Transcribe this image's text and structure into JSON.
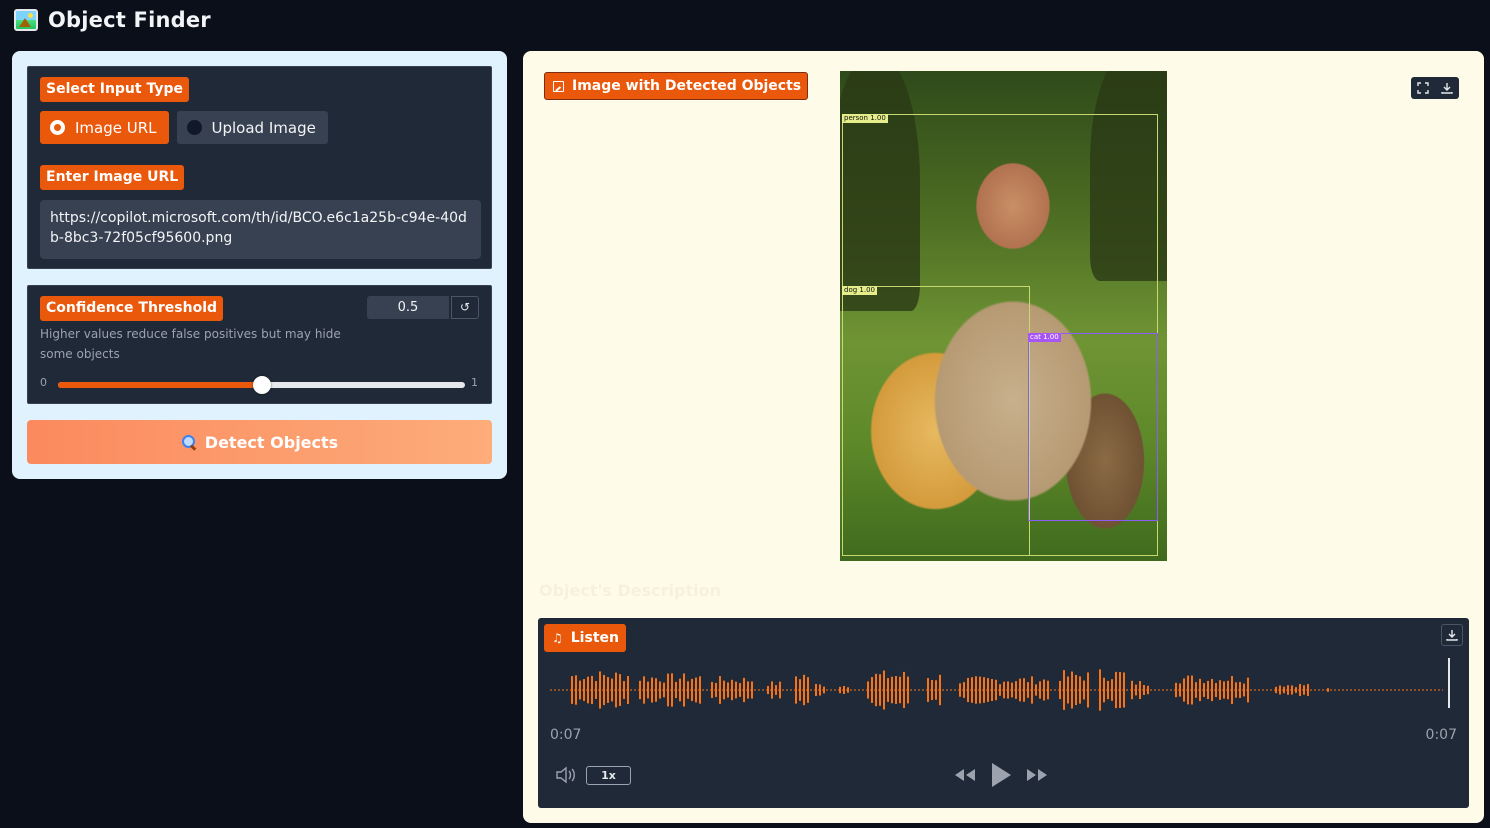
{
  "app": {
    "title": "Object Finder",
    "logo_icon": "framed-picture-icon"
  },
  "input_panel": {
    "input_type": {
      "label": "Select Input Type",
      "options": [
        {
          "label": "Image URL",
          "selected": true
        },
        {
          "label": "Upload Image",
          "selected": false
        }
      ]
    },
    "url": {
      "label": "Enter Image URL",
      "value": "https://copilot.microsoft.com/th/id/BCO.e6c1a25b-c94e-40db-8bc3-72f05cf95600.png"
    },
    "threshold": {
      "label": "Confidence Threshold",
      "value": "0.5",
      "info": "Higher values reduce false positives but may hide some objects",
      "min": "0",
      "max": "1",
      "fraction": 0.5,
      "reset_icon": "undo-icon"
    },
    "detect_button": {
      "label": "Detect Objects",
      "icon": "magnifying-glass-icon"
    }
  },
  "output_panel": {
    "image_label": "Image with Detected Objects",
    "detections": [
      {
        "label": "person 1.00"
      },
      {
        "label": "dog 1.00"
      },
      {
        "label": "cat 1.00"
      }
    ],
    "description_heading": "Object's Description",
    "audio": {
      "label": "Listen",
      "current_time": "0:07",
      "duration": "0:07",
      "speed": "1x"
    }
  },
  "colors": {
    "accent": "#ea580c",
    "background": "#0b0f19",
    "left_panel": "#e0f2fe",
    "right_panel": "#fefbe8",
    "waveform": "#f97316"
  }
}
